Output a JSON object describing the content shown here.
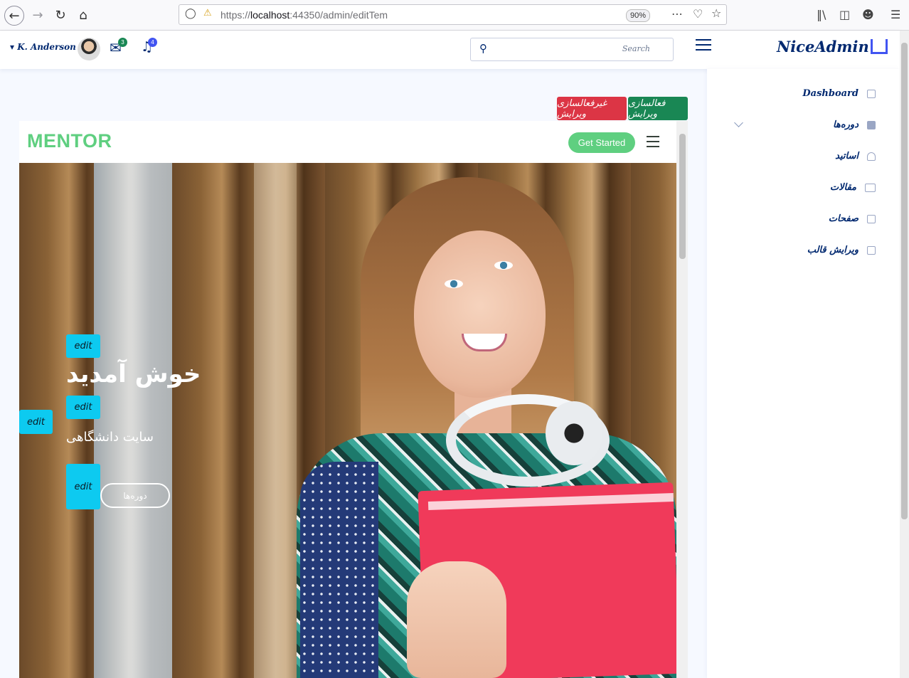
{
  "browser": {
    "url_prefix": "https://",
    "url_host": "localhost",
    "url_rest": ":44350/admin/editTem",
    "zoom": "90%"
  },
  "header": {
    "user_name": "K. Anderson",
    "messages_count": "3",
    "notifications_count": "4",
    "search_placeholder": "Search",
    "logo": "NiceAdmin"
  },
  "sidebar": {
    "items": [
      {
        "label": "Dashboard",
        "icon": "grid-icon"
      },
      {
        "label": "دوره‌ها",
        "icon": "book-icon"
      },
      {
        "label": "اساتید",
        "icon": "person-icon"
      },
      {
        "label": "مقالات",
        "icon": "journal-icon"
      },
      {
        "label": "صفحات",
        "icon": "page-icon"
      },
      {
        "label": "ویرایش قالب",
        "icon": "page-icon"
      }
    ]
  },
  "actions": {
    "enable_edit": "فعالسازی ویرایش",
    "disable_edit": "غیرفعالسازی ویرایش"
  },
  "preview": {
    "logo": "MENTOR",
    "get_started": "Get Started",
    "edit_label": "edit",
    "hero_title": "خوش آمدید",
    "hero_subtitle": "سایت دانشگاهی",
    "hero_button": "دوره‌ها"
  },
  "colors": {
    "accent": "#012970",
    "mentor_green": "#5fcf80",
    "edit_cyan": "#0dcaf0",
    "btn_green": "#198754",
    "btn_red": "#dc3545"
  }
}
